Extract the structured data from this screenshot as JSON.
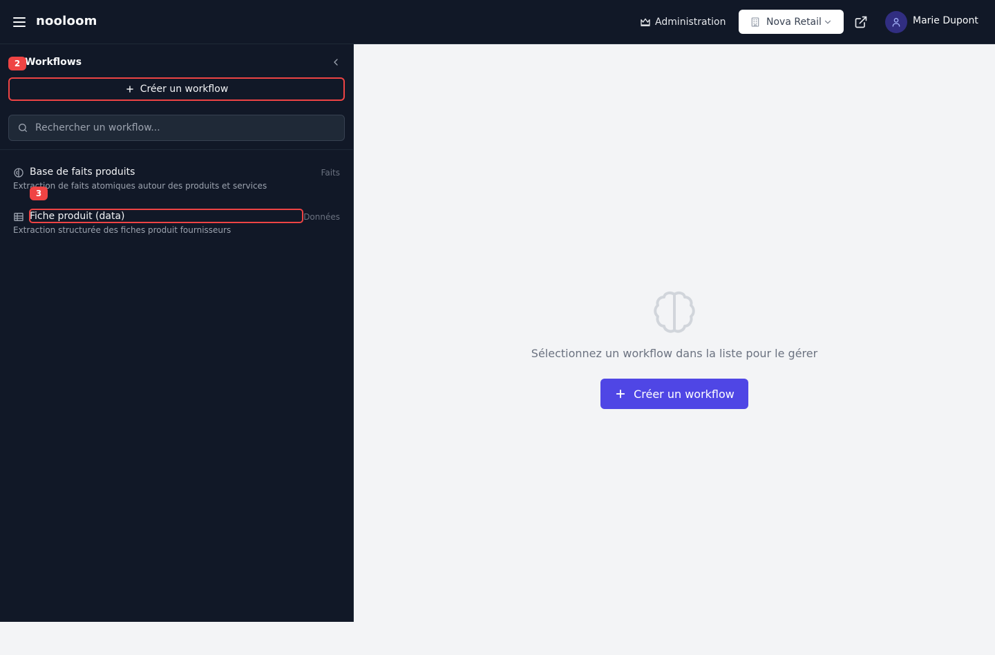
{
  "header": {
    "logo": "nooloom",
    "admin_label": "Administration",
    "org_label": "Nova Retail",
    "user_name": "Marie Dupont"
  },
  "sidebar": {
    "title": "Workflows",
    "title_badge": "2",
    "create_label": "Créer un workflow",
    "search_placeholder": "Rechercher un workflow...",
    "items": [
      {
        "name": "Base de faits produits",
        "tag": "Faits",
        "description": "Extraction de faits atomiques autour des produits et services",
        "icon": "brain-icon"
      },
      {
        "name": "Fiche produit (data)",
        "tag": "Données",
        "description": "Extraction structurée des fiches produit fournisseurs",
        "icon": "table-icon",
        "badge": "3"
      }
    ]
  },
  "main": {
    "empty_text": "Sélectionnez un workflow dans la liste pour le gérer",
    "create_label": "Créer un workflow"
  },
  "colors": {
    "sidebar_bg": "#111827",
    "accent": "#4f46e5",
    "highlight": "#ef4444",
    "main_bg": "#f3f4f6"
  }
}
